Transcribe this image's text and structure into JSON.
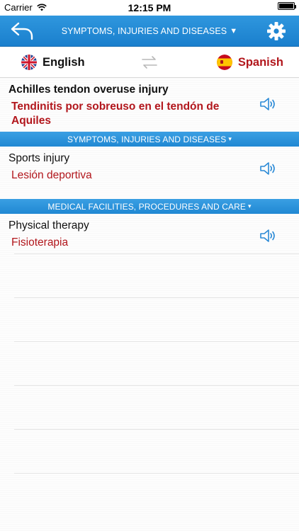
{
  "status_bar": {
    "carrier": "Carrier",
    "time": "12:15 PM",
    "battery_level": 1.0
  },
  "nav": {
    "title": "SYMPTOMS, INJURIES AND DISEASES",
    "title_caret": "▼",
    "back_icon": "back-arrow-icon",
    "settings_icon": "gear-icon",
    "accent_color": "#1f86d2"
  },
  "languages": {
    "source": "English",
    "target": "Spanish",
    "target_color": "#b2161c",
    "swap_icon": "swap-arrows-icon"
  },
  "list": [
    {
      "type": "entry",
      "term": "Achilles tendon overuse injury",
      "translation": "Tendinitis por sobreuso en el tendón de Aquiles"
    },
    {
      "type": "section",
      "label": "SYMPTOMS, INJURIES AND DISEASES",
      "caret": "▾"
    },
    {
      "type": "entry",
      "term": "Sports injury",
      "translation": "Lesión deportiva"
    },
    {
      "type": "section",
      "label": "MEDICAL FACILITIES, PROCEDURES AND CARE",
      "caret": "▾"
    },
    {
      "type": "entry",
      "term": "Physical therapy",
      "translation": "Fisioterapia"
    }
  ]
}
